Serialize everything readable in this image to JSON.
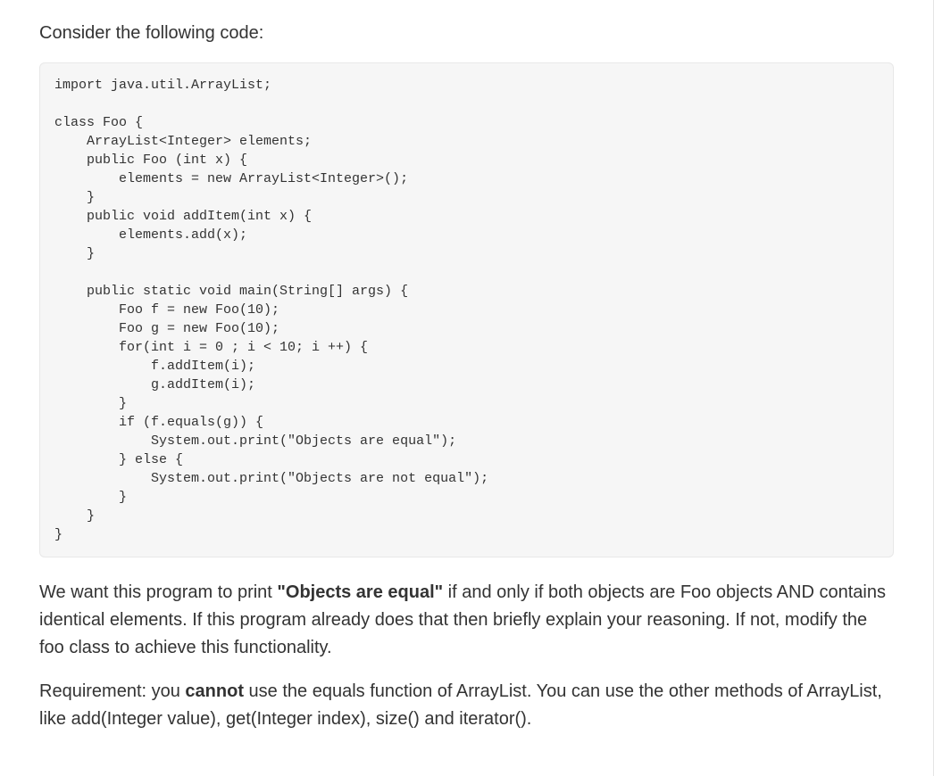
{
  "intro": "Consider the following code:",
  "code": "import java.util.ArrayList;\n\nclass Foo {\n    ArrayList<Integer> elements;\n    public Foo (int x) {\n        elements = new ArrayList<Integer>();\n    }\n    public void addItem(int x) {\n        elements.add(x);\n    }\n\n    public static void main(String[] args) {\n        Foo f = new Foo(10);\n        Foo g = new Foo(10);\n        for(int i = 0 ; i < 10; i ++) {\n            f.addItem(i);\n            g.addItem(i);\n        }\n        if (f.equals(g)) {\n            System.out.print(\"Objects are equal\");\n        } else {\n            System.out.print(\"Objects are not equal\");\n        }\n    }\n}",
  "para1": {
    "part1": "We want this program to print ",
    "bold1": "\"Objects are equal\"",
    "part2": " if and only if both objects are Foo objects AND contains identical elements. If this program already does that then briefly explain your reasoning. If not, modify the foo class to achieve this functionality."
  },
  "para2": {
    "part1": "Requirement: you ",
    "bold1": "cannot",
    "part2": " use the equals function of ArrayList. You can use the other methods of ArrayList, like add(Integer value), get(Integer index), size() and iterator()."
  }
}
